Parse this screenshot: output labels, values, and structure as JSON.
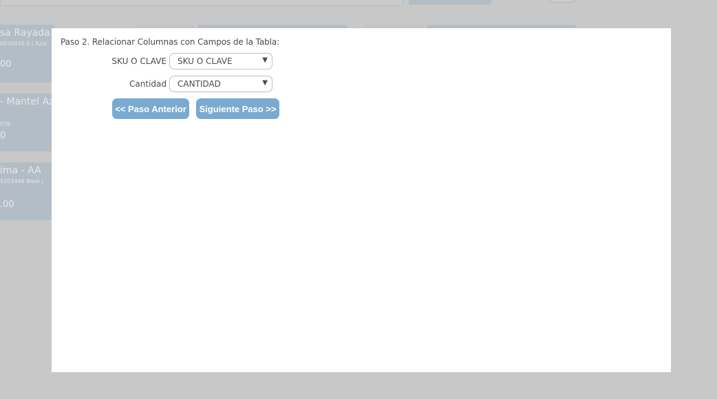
{
  "background": {
    "cards": [
      {
        "title": "sa Rayada -",
        "subtitle": "0030010 S | Azul",
        "price": "00"
      },
      {
        "title": "- Mantel Azu",
        "subtitle": "078",
        "price": "0"
      },
      {
        "title": "ima - AA",
        "subtitle": "5103446 Bash |",
        "price": ".00"
      }
    ]
  },
  "modal": {
    "step_title": "Paso 2. Relacionar Columnas con Campos de la Tabla:",
    "fields": [
      {
        "label": "SKU O CLAVE",
        "selected": "SKU O CLAVE"
      },
      {
        "label": "Cantidad",
        "selected": "CANTIDAD"
      }
    ],
    "buttons": {
      "prev_label": "<< Paso Anterior",
      "next_label": "Siguiente Paso >>"
    }
  },
  "icons": {
    "dropdown_arrow": "▼"
  },
  "colors": {
    "overlay": "#c8c8c8",
    "button": "#7aaad0",
    "background_tile": "#b3bdc6"
  }
}
